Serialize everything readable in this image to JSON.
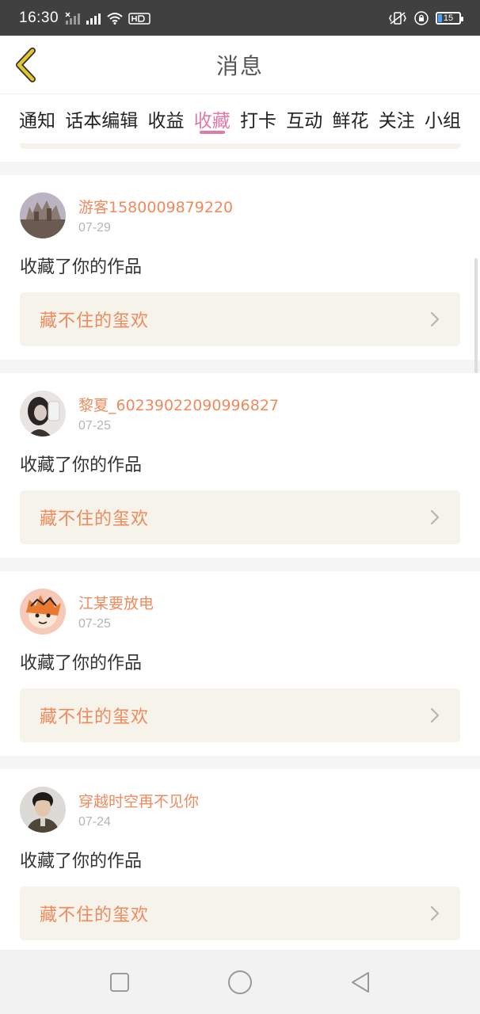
{
  "status_bar": {
    "time": "16:30",
    "battery_level": "15",
    "colors": {
      "background": "#404040",
      "battery_accent": "#4aa3ff"
    }
  },
  "header": {
    "title": "消息",
    "back_icon": "chevron-left-icon",
    "back_color": "#e3c72c"
  },
  "tabs": [
    {
      "label": "通知",
      "active": false
    },
    {
      "label": "话本编辑",
      "active": false
    },
    {
      "label": "收益",
      "active": false
    },
    {
      "label": "收藏",
      "active": true
    },
    {
      "label": "打卡",
      "active": false
    },
    {
      "label": "互动",
      "active": false
    },
    {
      "label": "鲜花",
      "active": false
    },
    {
      "label": "关注",
      "active": false
    },
    {
      "label": "小组",
      "active": false
    }
  ],
  "colors": {
    "accent_pink": "#e07aa8",
    "username_orange": "#f08a5d",
    "work_bg": "#f5f3ea"
  },
  "messages": [
    {
      "username": "游客1580009879220",
      "date": "07-29",
      "action": "收藏了你的作品",
      "work_title": "藏不住的玺欢"
    },
    {
      "username": "黎夏_60239022090996827",
      "date": "07-25",
      "action": "收藏了你的作品",
      "work_title": "藏不住的玺欢"
    },
    {
      "username": "江某要放电",
      "date": "07-25",
      "action": "收藏了你的作品",
      "work_title": "藏不住的玺欢"
    },
    {
      "username": "穿越时空再不见你",
      "date": "07-24",
      "action": "收藏了你的作品",
      "work_title": "藏不住的玺欢"
    }
  ],
  "nav_bar": {
    "icons": [
      "square-recents-icon",
      "circle-home-icon",
      "triangle-back-icon"
    ]
  }
}
